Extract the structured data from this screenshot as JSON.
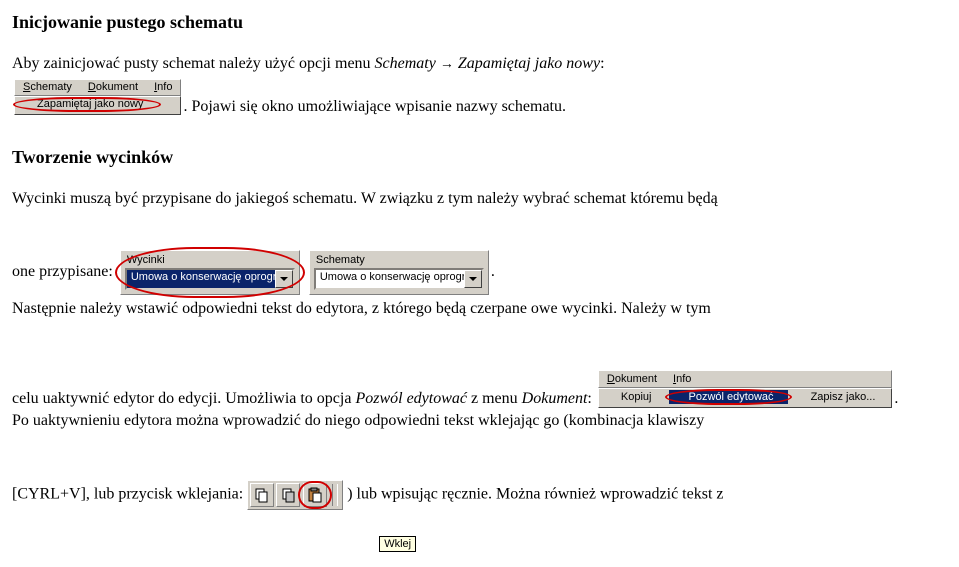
{
  "title": "Inicjowanie pustego schematu",
  "para1_a": "Aby zainicjować pusty schemat należy użyć opcji menu ",
  "para1_ital": "Schematy ",
  "para1_arrow": "→",
  "para1_ital2": " Zapamiętaj jako nowy",
  "para1_colon": ":",
  "menu1": {
    "items": [
      "Schematy",
      "Dokument",
      "Info"
    ],
    "rowLabel": "Zapamiętaj jako nowy"
  },
  "para1_tail": ". Pojawi się okno umożliwiające wpisanie nazwy schematu.",
  "title2": "Tworzenie wycinków",
  "para2_a": "Wycinki muszą być przypisane do jakiegoś schematu. W związku z tym należy wybrać schemat któremu będą",
  "para2_b": "one przypisane: ",
  "combo1": {
    "label": "Wycinki",
    "value": "Umowa o konserwację oprogra"
  },
  "combo2": {
    "label": "Schematy",
    "value": "Umowa o konserwację oprogra"
  },
  "para2_tail": ".",
  "para3_a": "Następnie należy wstawić odpowiedni tekst do edytora, z którego będą czerpane owe wycinki. Należy w tym",
  "para3_b": "celu uaktywnić edytor do edycji. Umożliwia to opcja ",
  "para3_ital": "Pozwól edytować",
  "para3_c": " z menu ",
  "para3_ital2": "Dokument",
  "para3_colon": ": ",
  "menu3": {
    "items": [
      "Dokument",
      "Info"
    ],
    "rows": [
      "Kopiuj",
      "Pozwól edytować",
      "Zapisz jako..."
    ]
  },
  "para3_tail": ".",
  "para4_a": "Po uaktywnieniu edytora można wprowadzić do niego odpowiedni tekst wklejając go (kombinacja klawiszy",
  "para5_a": "[CYRL+V], lub przycisk wklejania: ",
  "toolbar": {
    "tooltip": "Wklej"
  },
  "para5_b": ") lub wpisując ręcznie. Można również wprowadzić tekst z"
}
